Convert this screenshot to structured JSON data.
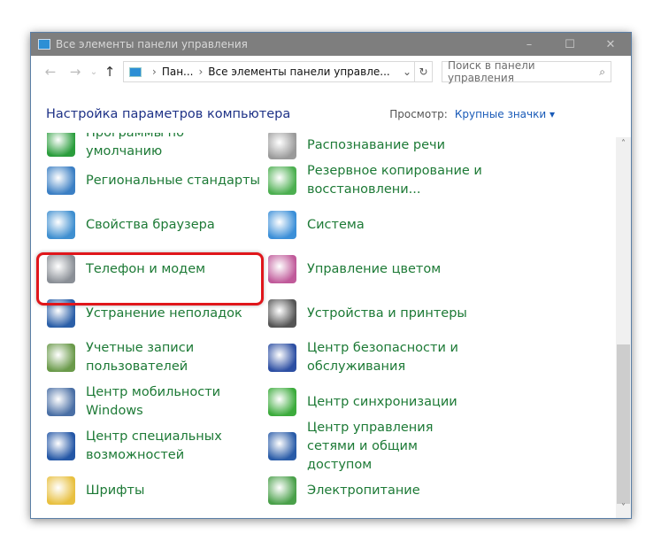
{
  "window": {
    "title": "Все элементы панели управления",
    "minimize": "–",
    "maximize": "☐",
    "close": "✕"
  },
  "toolbar": {
    "back": "←",
    "forward": "→",
    "recent": "⌄",
    "up": "↑",
    "crumbs": [
      "Пан...",
      "Все элементы панели управле..."
    ],
    "dropdown": "⌄",
    "refresh": "↻",
    "search_placeholder": "Поиск в панели управления",
    "search_icon": "⌕"
  },
  "header": {
    "title": "Настройка параметров компьютера",
    "view_label": "Просмотр:",
    "view_value": "Крупные значки ▾"
  },
  "left": [
    {
      "label": "Программы по умолчанию",
      "shown": "умолчанию",
      "icon": "default-programs-icon",
      "color": "#2a9d3c"
    },
    {
      "label": "Региональные стандарты",
      "icon": "region-clock-icon",
      "color": "#3b7fc4"
    },
    {
      "label": "Свойства браузера",
      "icon": "internet-options-icon",
      "color": "#3f8fd0"
    },
    {
      "label": "Телефон и модем",
      "icon": "phone-modem-icon",
      "color": "#8a8f96"
    },
    {
      "label": "Устранение неполадок",
      "icon": "troubleshooting-icon",
      "color": "#2b5fa8"
    },
    {
      "label": "Учетные записи пользователей",
      "icon": "user-accounts-icon",
      "color": "#6a9a4a"
    },
    {
      "label": "Центр мобильности Windows",
      "icon": "mobility-center-icon",
      "color": "#4a6fa5"
    },
    {
      "label": "Центр специальных возможностей",
      "icon": "ease-of-access-icon",
      "color": "#2457a6"
    },
    {
      "label": "Шрифты",
      "icon": "fonts-icon",
      "color": "#e8c040"
    }
  ],
  "right": [
    {
      "label": "Распознавание речи",
      "icon": "microphone-icon",
      "color": "#9a9a9a"
    },
    {
      "label": "Резервное копирование и восстановлени...",
      "icon": "backup-icon",
      "color": "#4caf50"
    },
    {
      "label": "Система",
      "icon": "system-icon",
      "color": "#3b8fd8"
    },
    {
      "label": "Управление цветом",
      "icon": "color-management-icon",
      "color": "#c05a9a"
    },
    {
      "label": "Устройства и принтеры",
      "icon": "printer-icon",
      "color": "#555555"
    },
    {
      "label": "Центр безопасности и обслуживания",
      "icon": "security-flag-icon",
      "color": "#2d4fa3"
    },
    {
      "label": "Центр синхронизации",
      "icon": "sync-center-icon",
      "color": "#3cab3c"
    },
    {
      "label": "Центр управления сетями и общим доступом",
      "icon": "network-icon",
      "color": "#2a5ca8"
    },
    {
      "label": "Электропитание",
      "icon": "power-options-icon",
      "color": "#4aa04a"
    }
  ],
  "scrollbar": {
    "up": "˄",
    "down": "˅",
    "position_fraction": 0.6
  }
}
